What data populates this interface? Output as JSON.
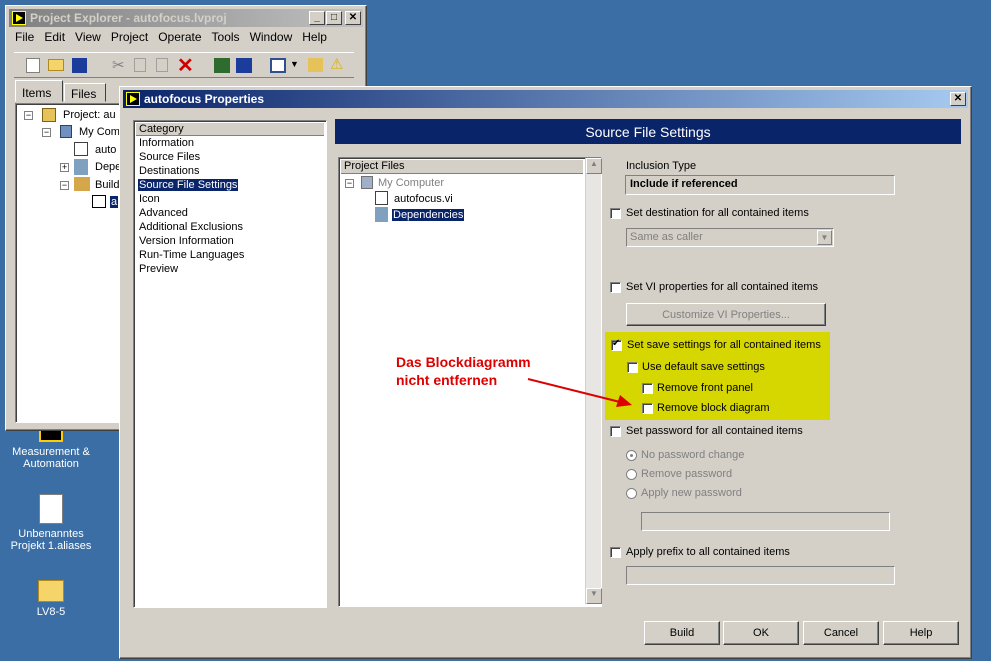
{
  "desktop": {
    "icons": [
      {
        "label": "Measurement & Automation"
      },
      {
        "label": "Unbenanntes Projekt 1.aliases"
      },
      {
        "label": "LV8-5"
      }
    ]
  },
  "explorer": {
    "title": "Project Explorer - autofocus.lvproj",
    "menu": [
      "File",
      "Edit",
      "View",
      "Project",
      "Operate",
      "Tools",
      "Window",
      "Help"
    ],
    "tabs": [
      "Items",
      "Files"
    ],
    "tree": {
      "project": "Project: au",
      "computer": "My Com",
      "vi": "auto",
      "deps": "Depe",
      "build": "Build",
      "spec": "a"
    }
  },
  "dialog": {
    "title": "autofocus Properties",
    "category_header": "Category",
    "categories": [
      "Information",
      "Source Files",
      "Destinations",
      "Source File Settings",
      "Icon",
      "Advanced",
      "Additional Exclusions",
      "Version Information",
      "Run-Time Languages",
      "Preview"
    ],
    "selected_category": "Source File Settings",
    "banner": "Source File Settings",
    "project_files_header": "Project Files",
    "files": {
      "computer": "My Computer",
      "vi": "autofocus.vi",
      "deps": "Dependencies"
    },
    "inclusion_type_label": "Inclusion Type",
    "inclusion_type_value": "Include if referenced",
    "set_destination": "Set destination for all contained items",
    "destination_value": "Same as caller",
    "set_vi_props": "Set VI properties for all contained items",
    "customize_btn": "Customize VI Properties...",
    "set_save": "Set save settings for all contained items",
    "use_default_save": "Use default save settings",
    "remove_front_panel": "Remove front panel",
    "remove_block_diagram": "Remove block diagram",
    "set_password": "Set password for all contained items",
    "no_password_change": "No password change",
    "remove_password": "Remove password",
    "apply_new_password": "Apply new password",
    "apply_prefix": "Apply prefix to all contained items",
    "buttons": {
      "build": "Build",
      "ok": "OK",
      "cancel": "Cancel",
      "help": "Help"
    }
  },
  "annotation": {
    "line1": "Das Blockdiagramm",
    "line2": "nicht entfernen"
  },
  "colors": {
    "highlight": "#d6d600",
    "annotation": "#dd0000",
    "banner": "#0a246a"
  }
}
